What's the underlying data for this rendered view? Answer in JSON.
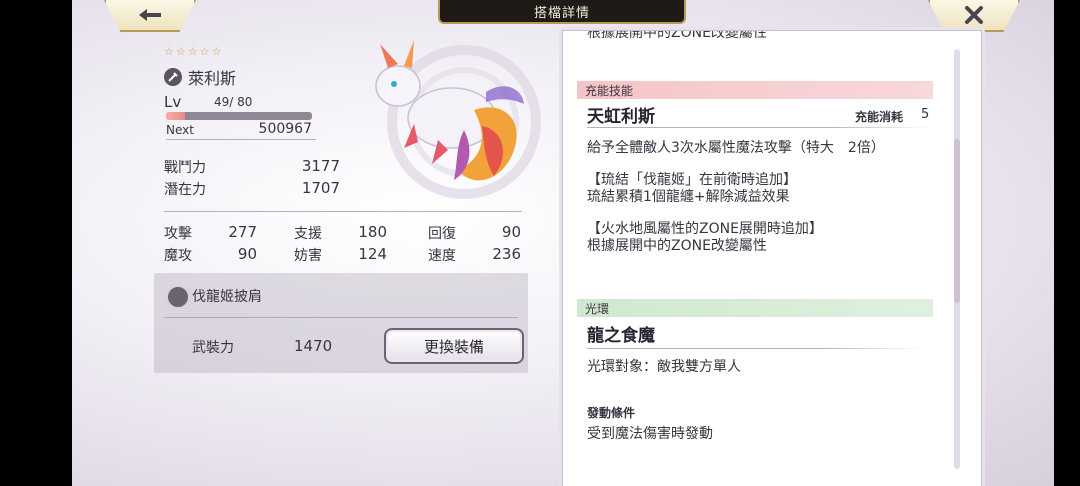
{
  "header": {
    "title": "搭檔詳情",
    "back_icon": "back-arrow-icon",
    "close_icon": "close-icon",
    "accent_color": "#b99a55"
  },
  "character": {
    "stars": [
      "☆",
      "☆",
      "☆",
      "☆",
      "☆"
    ],
    "name": "萊利斯",
    "lv_label": "Lv",
    "level": "49/ 80",
    "exp_fraction": 0.13,
    "next_label": "Next",
    "next_value": "500967",
    "battle_power_label": "戰鬥力",
    "battle_power": "3177",
    "potential_label": "潛在力",
    "potential": "1707"
  },
  "stats": [
    {
      "label": "攻擊",
      "value": "277"
    },
    {
      "label": "支援",
      "value": "180"
    },
    {
      "label": "回復",
      "value": "90"
    },
    {
      "label": "魔攻",
      "value": "90"
    },
    {
      "label": "妨害",
      "value": "124"
    },
    {
      "label": "速度",
      "value": "236"
    }
  ],
  "equipment": {
    "name": "伐龍姬披肩",
    "power_label": "武裝力",
    "power_value": "1470",
    "change_button": "更換裝備"
  },
  "details": {
    "cut_line": "根據展開中的ZONE改變屬性",
    "skill_section": "充能技能",
    "skill_name": "天虹利斯",
    "cost_label": "充能消耗",
    "cost_value": "5",
    "skill_desc": "給予全體敵人3次水屬性魔法攻擊（特大　2倍）",
    "bond_line1": "【琉結「伐龍姬」在前衛時追加】",
    "bond_line2": "琉結累積1個龍纏+解除減益效果",
    "zone_line1": "【火水地風屬性的ZONE展開時追加】",
    "zone_line2": "根據展開中的ZONE改變屬性",
    "aura_section": "光環",
    "aura_name": "龍之食魔",
    "aura_target": "光環對象：敵我雙方單人",
    "trigger_label": "發動條件",
    "trigger_text": "受到魔法傷害時發動",
    "pink_color": "#f4c4c6",
    "green_color": "#cfe8cf"
  }
}
